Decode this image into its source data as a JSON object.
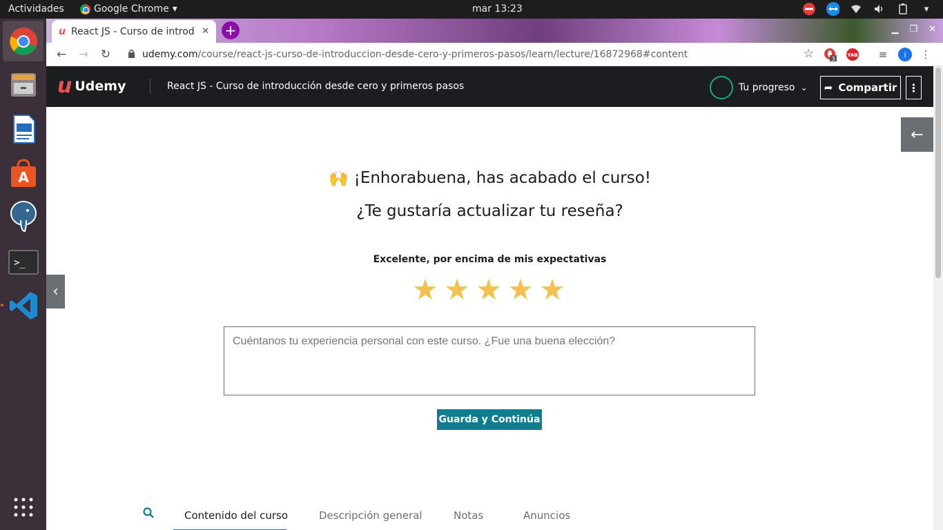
{
  "os": {
    "activities": "Actividades",
    "app_name": "Google Chrome",
    "clock": "mar 13:23"
  },
  "browser": {
    "tab_title": "React JS - Curso de introd",
    "url_domain": "udemy.com",
    "url_path": "/course/react-js-curso-de-introduccion-desde-cero-y-primeros-pasos/learn/lecture/16872968#content",
    "ext_badge": "3",
    "yab_label": "YAB"
  },
  "udemy": {
    "logo_text": "Udemy",
    "course_title": "React JS - Curso de introducción desde cero y primeros pasos",
    "progress_label": "Tu progreso",
    "share_label": "Compartir"
  },
  "review": {
    "emoji": "🙌",
    "congrats": "¡Enhorabuena, has acabado el curso!",
    "question": "¿Te gustaría actualizar tu reseña?",
    "rating_label": "Excelente, por encima de mis expectativas",
    "rating": 5,
    "placeholder": "Cuéntanos tu experiencia personal con este curso. ¿Fue una buena elección?",
    "save_label": "Guarda y Continúa"
  },
  "tabs": {
    "items": [
      "Contenido del curso",
      "Descripción general",
      "Notas",
      "Anuncios"
    ],
    "active": "Contenido del curso"
  },
  "colors": {
    "accent": "#0f7c90",
    "star": "#f4c150",
    "header_bg": "#1c1d1f",
    "progress_ring": "#1ca67c"
  }
}
